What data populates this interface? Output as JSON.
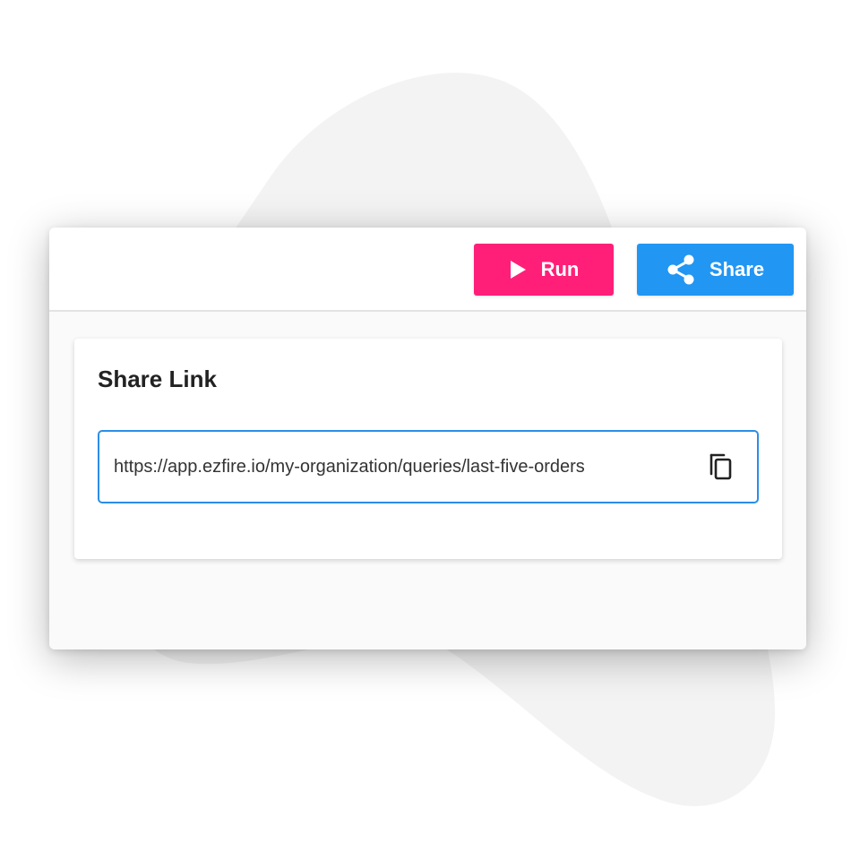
{
  "toolbar": {
    "run_label": "Run",
    "share_label": "Share",
    "run_icon": "play-icon",
    "share_icon": "share-icon"
  },
  "share_card": {
    "title": "Share Link",
    "link": "https://app.ezfire.io/my-organization/queries/last-five-orders",
    "copy_icon": "copy-icon"
  },
  "colors": {
    "run_button": "#ff1f78",
    "share_button": "#2196f3",
    "field_border": "#2b8ee6",
    "background_blob": "#f3f3f3"
  }
}
